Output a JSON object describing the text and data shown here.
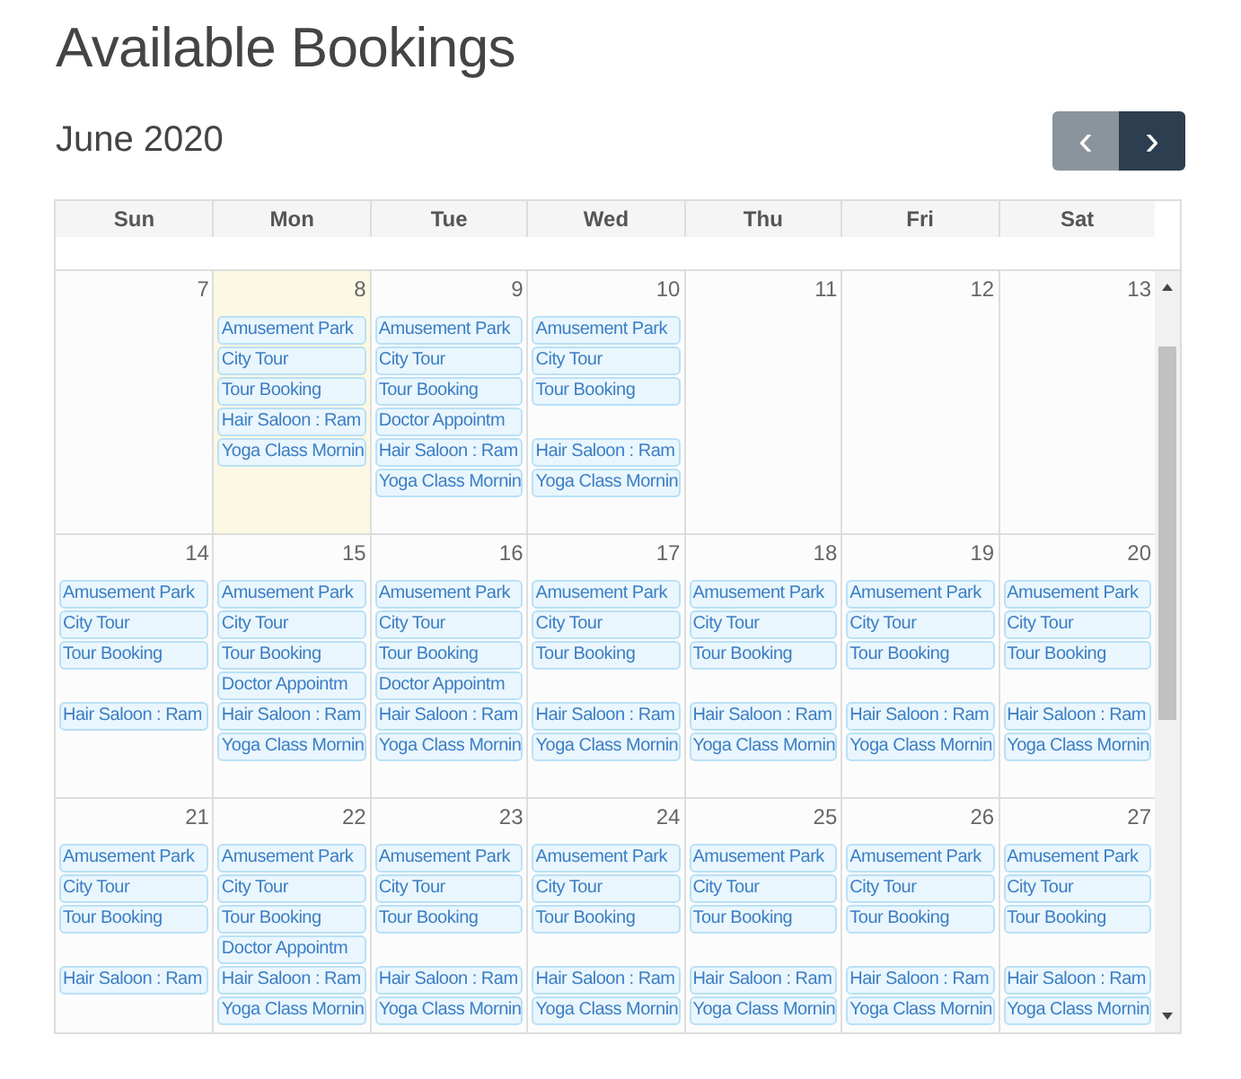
{
  "title": "Available Bookings",
  "month": "June 2020",
  "nav": [
    {
      "glyph": "‹",
      "kind": "prev",
      "disabled": true
    },
    {
      "glyph": "›",
      "kind": "next",
      "disabled": false
    }
  ],
  "weekdays": [
    "Sun",
    "Mon",
    "Tue",
    "Wed",
    "Thu",
    "Fri",
    "Sat"
  ],
  "weeks": [
    [
      {
        "day": "7",
        "today": false
      },
      {
        "day": "8",
        "today": true,
        "events": [
          "Amusement Park",
          "City Tour",
          "Tour Booking",
          "Hair Saloon : Ram",
          "Yoga Class Mornin"
        ]
      },
      {
        "day": "9",
        "today": false,
        "events": [
          "Amusement Park",
          "City Tour",
          "Tour Booking",
          "Doctor Appointm",
          "Hair Saloon : Ram",
          "Yoga Class Mornin"
        ]
      },
      {
        "day": "10",
        "today": false,
        "events": [
          "Amusement Park",
          "City Tour",
          "Tour Booking"
        ],
        "lower_events": [
          "Hair Saloon : Ram",
          "Yoga Class Mornin"
        ]
      },
      {
        "day": "11",
        "today": false
      },
      {
        "day": "12",
        "today": false
      },
      {
        "day": "13",
        "today": false
      }
    ],
    [
      {
        "day": "14",
        "today": false,
        "events": [
          "Amusement Park",
          "City Tour",
          "Tour Booking"
        ],
        "lower_events": [
          "Hair Saloon : Ram"
        ]
      },
      {
        "day": "15",
        "today": false,
        "events": [
          "Amusement Park",
          "City Tour",
          "Tour Booking",
          "Doctor Appointm",
          "Hair Saloon : Ram",
          "Yoga Class Mornin"
        ]
      },
      {
        "day": "16",
        "today": false,
        "events": [
          "Amusement Park",
          "City Tour",
          "Tour Booking",
          "Doctor Appointm",
          "Hair Saloon : Ram",
          "Yoga Class Mornin"
        ]
      },
      {
        "day": "17",
        "today": false,
        "events": [
          "Amusement Park",
          "City Tour",
          "Tour Booking"
        ],
        "lower_events": [
          "Hair Saloon : Ram",
          "Yoga Class Mornin"
        ]
      },
      {
        "day": "18",
        "today": false,
        "events": [
          "Amusement Park",
          "City Tour",
          "Tour Booking"
        ],
        "lower_events": [
          "Hair Saloon : Ram",
          "Yoga Class Mornin"
        ]
      },
      {
        "day": "19",
        "today": false,
        "events": [
          "Amusement Park",
          "City Tour",
          "Tour Booking"
        ],
        "lower_events": [
          "Hair Saloon : Ram",
          "Yoga Class Mornin"
        ]
      },
      {
        "day": "20",
        "today": false,
        "events": [
          "Amusement Park",
          "City Tour",
          "Tour Booking"
        ],
        "lower_events": [
          "Hair Saloon : Ram",
          "Yoga Class Mornin"
        ]
      }
    ],
    [
      {
        "day": "21",
        "today": false,
        "events": [
          "Amusement Park",
          "City Tour",
          "Tour Booking"
        ],
        "lower_events": [
          "Hair Saloon : Ram"
        ]
      },
      {
        "day": "22",
        "today": false,
        "events": [
          "Amusement Park",
          "City Tour",
          "Tour Booking",
          "Doctor Appointm",
          "Hair Saloon : Ram",
          "Yoga Class Mornin"
        ]
      },
      {
        "day": "23",
        "today": false,
        "events": [
          "Amusement Park",
          "City Tour",
          "Tour Booking"
        ],
        "lower_events": [
          "Hair Saloon : Ram",
          "Yoga Class Mornin"
        ]
      },
      {
        "day": "24",
        "today": false,
        "events": [
          "Amusement Park",
          "City Tour",
          "Tour Booking"
        ],
        "lower_events": [
          "Hair Saloon : Ram",
          "Yoga Class Mornin"
        ]
      },
      {
        "day": "25",
        "today": false,
        "events": [
          "Amusement Park",
          "City Tour",
          "Tour Booking"
        ],
        "lower_events": [
          "Hair Saloon : Ram",
          "Yoga Class Mornin"
        ]
      },
      {
        "day": "26",
        "today": false,
        "events": [
          "Amusement Park",
          "City Tour",
          "Tour Booking"
        ],
        "lower_events": [
          "Hair Saloon : Ram",
          "Yoga Class Mornin"
        ]
      },
      {
        "day": "27",
        "today": false,
        "events": [
          "Amusement Park",
          "City Tour",
          "Tour Booking"
        ],
        "lower_events": [
          "Hair Saloon : Ram",
          "Yoga Class Mornin"
        ]
      }
    ]
  ]
}
